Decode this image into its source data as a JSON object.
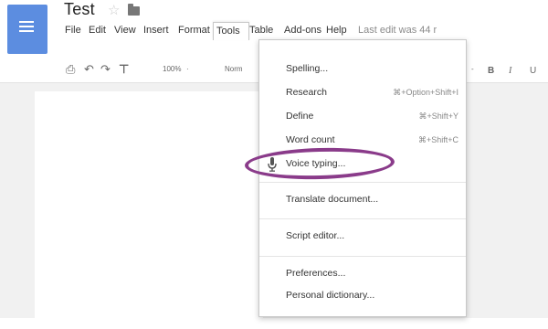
{
  "document": {
    "title": "Test",
    "last_edit": "Last edit was 44 r"
  },
  "menubar": {
    "items": [
      "File",
      "Edit",
      "View",
      "Insert",
      "Format",
      "Tools",
      "Table",
      "Add-ons",
      "Help"
    ],
    "active": "Tools"
  },
  "toolbar": {
    "zoom": "100%",
    "style": "Norm"
  },
  "tools_menu": {
    "items": [
      {
        "label": "Spelling...",
        "shortcut": ""
      },
      {
        "label": "Research",
        "shortcut": "⌘+Option+Shift+I"
      },
      {
        "label": "Define",
        "shortcut": "⌘+Shift+Y"
      },
      {
        "label": "Word count",
        "shortcut": "⌘+Shift+C"
      },
      {
        "label": "Voice typing...",
        "shortcut": ""
      },
      {
        "label": "Translate document...",
        "shortcut": ""
      },
      {
        "label": "Script editor...",
        "shortcut": ""
      },
      {
        "label": "Preferences...",
        "shortcut": ""
      },
      {
        "label": "Personal dictionary...",
        "shortcut": ""
      }
    ]
  },
  "colors": {
    "accent": "#5c8de0",
    "highlight": "#8a3b8a"
  },
  "icons": [
    "docs-logo-icon",
    "star-icon",
    "folder-icon",
    "print-icon",
    "undo-icon",
    "redo-icon",
    "paint-format-icon",
    "bold-icon",
    "italic-icon",
    "microphone-icon"
  ]
}
